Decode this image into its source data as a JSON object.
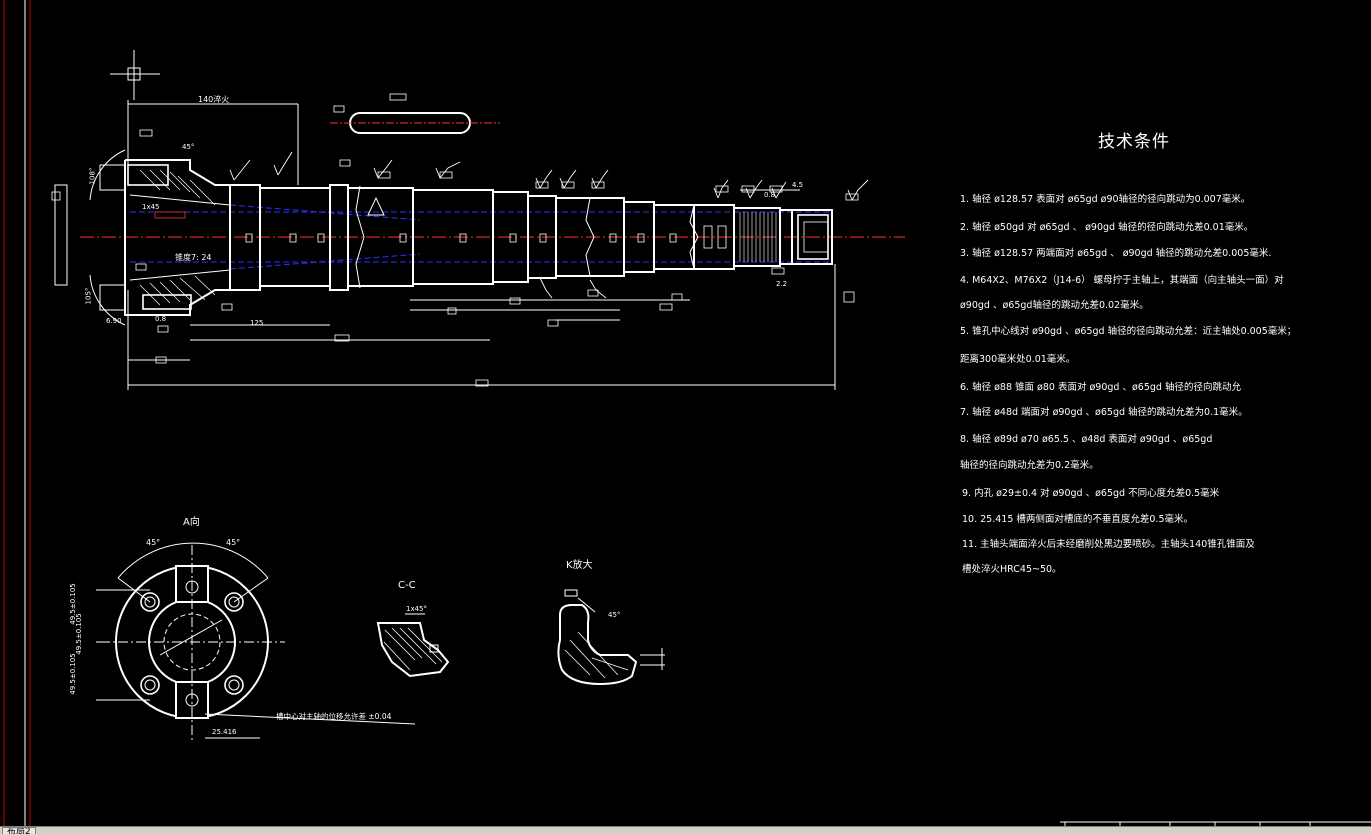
{
  "drawing": {
    "dims": {
      "top_length": "140淬火",
      "taper": "锥度7: 24",
      "dim_45_top": "45°",
      "dim_1x45": "1x45",
      "d_125": "125",
      "d_6_90": "6.90",
      "d_0_8": "0.8",
      "d_4_5": "4.5",
      "d_0_8b": "0.8",
      "d_2_2": "2.2",
      "d_108": "108°",
      "d_105": "105°"
    },
    "view_a": {
      "title": "A向",
      "angle_left": "45°",
      "angle_right": "45°",
      "dim_left_1": "49.5±0.105",
      "dim_left_2": "49.5±0.105",
      "dim_left_3": "49.5±0.105",
      "note": "槽中心对主轴的位移允许差 ±0.04",
      "width": "25.416"
    },
    "view_cc": {
      "title": "C-C",
      "chamfer": "1x45°"
    },
    "view_k": {
      "title": "K放大",
      "angle": "45°"
    }
  },
  "tech": {
    "title": "技术条件",
    "items": [
      "1.  轴径  ø128.57         表面对  ø65gd     ø90轴径的径向跳动为0.007毫米。",
      "2.  轴径  ø50gd  对  ø65gd  、 ø90gd   轴径的径向跳动允差0.01毫米。",
      "3.  轴径  ø128.57     两端面对  ø65gd   、 ø90gd  轴径的跳动允差0.005毫米.",
      "4.  M64X2、M76X2（J14-6）      螺母拧于主轴上，其端面（向主轴头一面）对",
      "     ø90gd  、ø65gd轴径的跳动允差0.02毫米。",
      "5.  锥孔中心线对  ø90gd  、ø65gd  轴径的径向跳动允差：近主轴处0.005毫米；",
      "     距离300毫米处0.01毫米。",
      "6.  轴径   ø88      锥面   ø80         表面对  ø90gd  、ø65gd  轴径的径向跳动允",
      "7.  轴径   ø48d      端面对  ø90gd  、ø65gd   轴径的跳动允差为0.1毫米。",
      "8.  轴径   ø89d       ø70  ø65.5   、ø48d         表面对   ø90gd  、ø65gd",
      "     轴径的径向跳动允差为0.2毫米。",
      "9.  内孔  ø29±0.4 对  ø90gd  、ø65gd  不同心度允差0.5毫米",
      "10.   25.415      槽两侧面对槽底的不垂直度允差0.5毫米。",
      "11.  主轴头端面淬火后未经磨削处黑边要喷砂。主轴头140锥孔锥面及",
      "       槽处淬火HRC45~50。"
    ]
  },
  "status": {
    "tab_label": "布局2"
  },
  "colors": {
    "background": "#000000",
    "lines": "#ffffff",
    "centerline": "#3030ff",
    "accent_red": "#ff0000",
    "status_bar": "#d4d0c8"
  }
}
